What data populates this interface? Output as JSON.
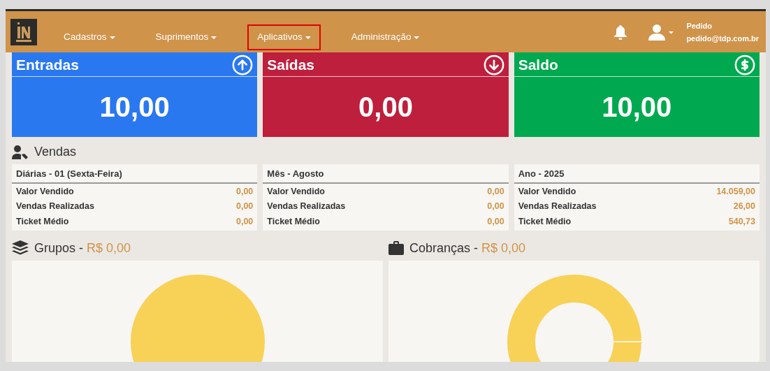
{
  "navbar": {
    "menus": [
      {
        "label": "Cadastros",
        "highlighted": false
      },
      {
        "label": "Suprimentos",
        "highlighted": false
      },
      {
        "label": "Aplicativos",
        "highlighted": true
      },
      {
        "label": "Administração",
        "highlighted": false
      }
    ],
    "user": {
      "name": "Pedido",
      "email": "pedido@tdp.com.br"
    }
  },
  "summary_cards": [
    {
      "title": "Entradas",
      "value": "10,00",
      "kind": "in",
      "color": "#2a78f0"
    },
    {
      "title": "Saídas",
      "value": "0,00",
      "kind": "out",
      "color": "#be1f3c"
    },
    {
      "title": "Saldo",
      "value": "10,00",
      "kind": "balance",
      "color": "#00a94f"
    }
  ],
  "sales": {
    "title": "Vendas",
    "periods": [
      {
        "heading": "Diárias - 01 (Sexta-Feira)",
        "rows": [
          {
            "label": "Valor Vendido",
            "value": "0,00"
          },
          {
            "label": "Vendas Realizadas",
            "value": "0,00"
          },
          {
            "label": "Ticket Médio",
            "value": "0,00"
          }
        ]
      },
      {
        "heading": "Mês - Agosto",
        "rows": [
          {
            "label": "Valor Vendido",
            "value": "0,00"
          },
          {
            "label": "Vendas Realizadas",
            "value": "0,00"
          },
          {
            "label": "Ticket Médio",
            "value": "0,00"
          }
        ]
      },
      {
        "heading": "Ano - 2025",
        "rows": [
          {
            "label": "Valor Vendido",
            "value": "14.059,00"
          },
          {
            "label": "Vendas Realizadas",
            "value": "26,00"
          },
          {
            "label": "Ticket Médio",
            "value": "540,73"
          }
        ]
      }
    ]
  },
  "panels": [
    {
      "title": "Grupos -",
      "amount": "R$ 0,00",
      "kind": "pie"
    },
    {
      "title": "Cobranças -",
      "amount": "R$ 0,00",
      "kind": "donut"
    }
  ]
}
